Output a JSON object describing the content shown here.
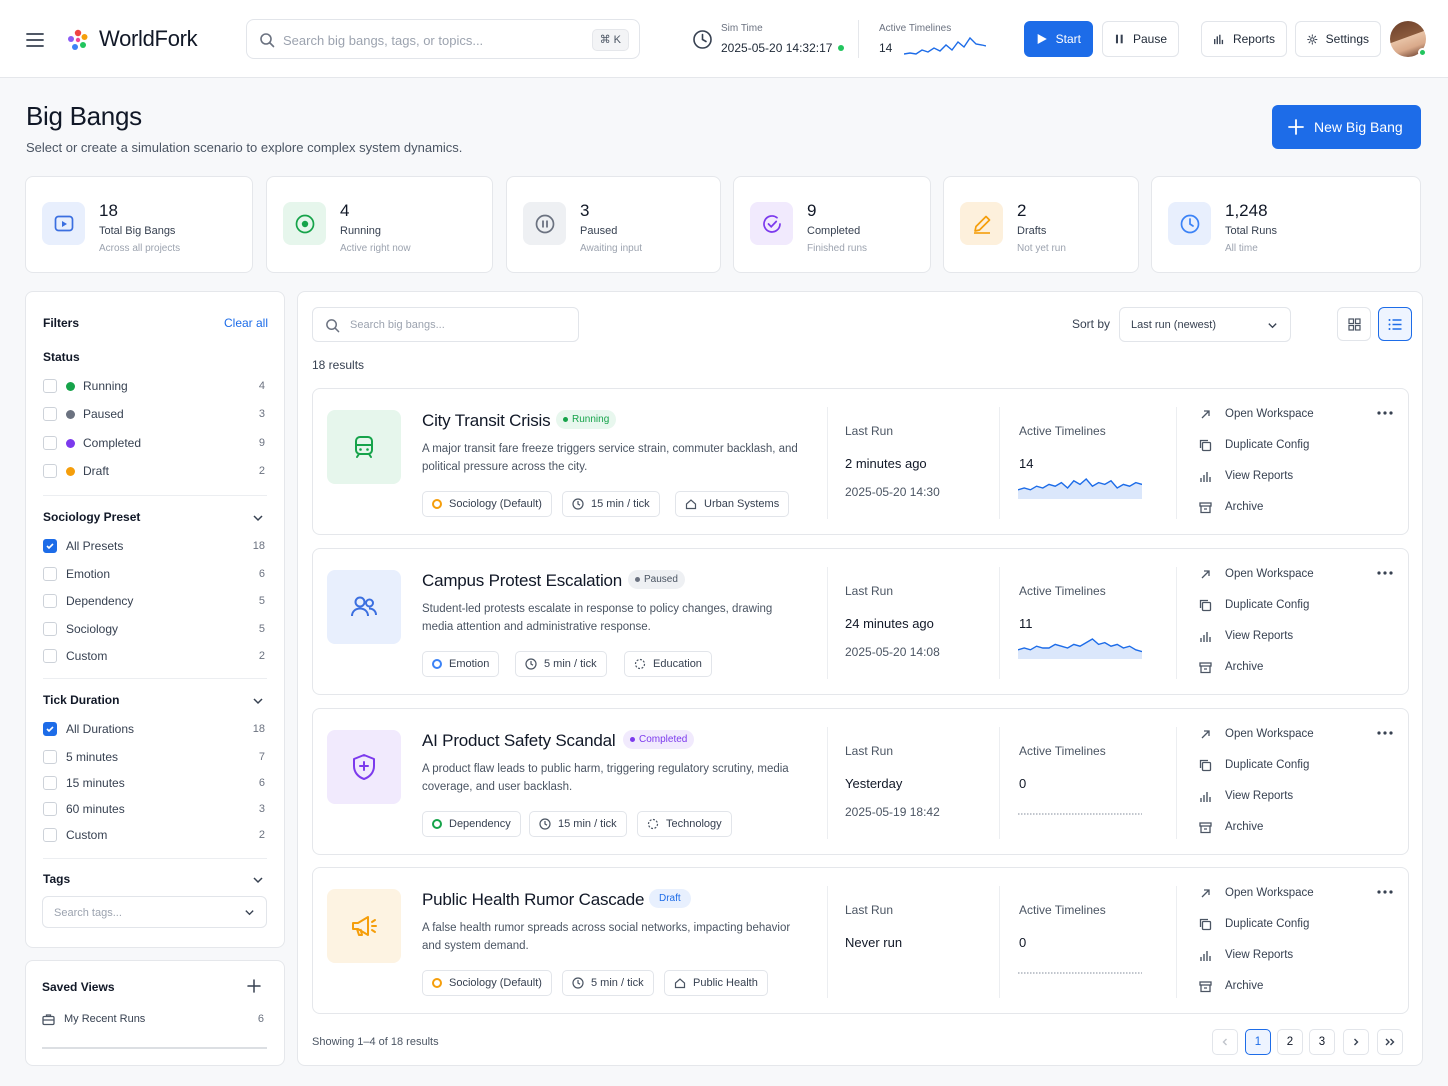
{
  "app": {
    "name": "WorldFork"
  },
  "search": {
    "placeholder": "Search big bangs, tags, or topics...",
    "shortcut": "⌘ K"
  },
  "sim": {
    "time_label": "Sim Time",
    "time_value": "2025-05-20 14:32:17",
    "timelines_label": "Active Timelines",
    "timelines_value": "14"
  },
  "toolbar": {
    "start": "Start",
    "pause": "Pause",
    "reports": "Reports",
    "settings": "Settings"
  },
  "page": {
    "title": "Big Bangs",
    "subtitle": "Select or create a simulation scenario to explore complex system dynamics.",
    "new_button": "New Big Bang"
  },
  "stats": [
    {
      "value": "18",
      "label": "Total Big Bangs",
      "sub": "Across all projects",
      "icon": "grid-play-icon",
      "color": "#3b6fe0"
    },
    {
      "value": "4",
      "label": "Running",
      "sub": "Active right now",
      "icon": "target-icon",
      "color": "#16a34a"
    },
    {
      "value": "3",
      "label": "Paused",
      "sub": "Awaiting input",
      "icon": "pause-circle-icon",
      "color": "#6b7280"
    },
    {
      "value": "9",
      "label": "Completed",
      "sub": "Finished runs",
      "icon": "check-circle-icon",
      "color": "#7c3aed"
    },
    {
      "value": "2",
      "label": "Drafts",
      "sub": "Not yet run",
      "icon": "pencil-icon",
      "color": "#f59e0b"
    },
    {
      "value": "1,248",
      "label": "Total Runs",
      "sub": "All time",
      "icon": "clock-icon",
      "color": "#3b82f6"
    }
  ],
  "filters": {
    "title": "Filters",
    "clear": "Clear all",
    "status_title": "Status",
    "status": [
      {
        "label": "Running",
        "count": "4",
        "color": "#16a34a"
      },
      {
        "label": "Paused",
        "count": "3",
        "color": "#6b7280"
      },
      {
        "label": "Completed",
        "count": "9",
        "color": "#7c3aed"
      },
      {
        "label": "Draft",
        "count": "2",
        "color": "#f59e0b"
      }
    ],
    "preset_title": "Sociology Preset",
    "presets": [
      {
        "label": "All Presets",
        "count": "18",
        "checked": true
      },
      {
        "label": "Emotion",
        "count": "6",
        "checked": false
      },
      {
        "label": "Dependency",
        "count": "5",
        "checked": false
      },
      {
        "label": "Sociology",
        "count": "5",
        "checked": false
      },
      {
        "label": "Custom",
        "count": "2",
        "checked": false
      }
    ],
    "tick_title": "Tick Duration",
    "ticks": [
      {
        "label": "All Durations",
        "count": "18",
        "checked": true
      },
      {
        "label": "5 minutes",
        "count": "7",
        "checked": false
      },
      {
        "label": "15 minutes",
        "count": "6",
        "checked": false
      },
      {
        "label": "60 minutes",
        "count": "3",
        "checked": false
      },
      {
        "label": "Custom",
        "count": "2",
        "checked": false
      }
    ],
    "tags_title": "Tags",
    "tags_placeholder": "Search tags..."
  },
  "saved": {
    "title": "Saved Views",
    "items": [
      {
        "label": "My Recent Runs",
        "count": "6"
      }
    ]
  },
  "list": {
    "search_placeholder": "Search big bangs...",
    "sort_label": "Sort by",
    "sort_value": "Last run (newest)",
    "results": "18 results",
    "last_run_label": "Last Run",
    "timelines_label": "Active Timelines",
    "actions": [
      "Open Workspace",
      "Duplicate Config",
      "View Reports",
      "Archive"
    ],
    "items": [
      {
        "title": "City Transit Crisis",
        "status": "Running",
        "status_color": "#16a34a",
        "status_bg": "#e8f7ee",
        "desc": "A major transit fare freeze triggers service strain, commuter backlash, and political pressure across the city.",
        "preset": "Sociology (Default)",
        "preset_color": "#f59e0b",
        "tick": "15 min / tick",
        "tag": "Urban Systems",
        "tag_icon": "home-icon",
        "last_run": "2 minutes ago",
        "last_run_date": "2025-05-20 14:30",
        "timelines": "14",
        "trend": [
          4,
          5,
          4,
          6,
          5,
          7,
          6,
          8,
          5,
          9,
          7,
          10,
          6,
          8,
          7,
          9,
          5,
          7,
          6,
          8,
          7
        ],
        "icon": "train-icon",
        "icon_color": "#16a34a",
        "thumb_bg": "#e6f6ec"
      },
      {
        "title": "Campus Protest Escalation",
        "status": "Paused",
        "status_color": "#4b5563",
        "status_bg": "#eef0f3",
        "desc": "Student-led protests escalate in response to policy changes, drawing media attention and administrative response.",
        "preset": "Emotion",
        "preset_color": "#3b82f6",
        "tick": "5 min / tick",
        "tag": "Education",
        "tag_icon": "dashed-circle-icon",
        "last_run": "24 minutes ago",
        "last_run_date": "2025-05-20 14:08",
        "timelines": "11",
        "trend": [
          4,
          5,
          4,
          6,
          5,
          5,
          7,
          6,
          5,
          7,
          6,
          8,
          10,
          7,
          8,
          6,
          7,
          5,
          6,
          4,
          3
        ],
        "icon": "users-icon",
        "icon_color": "#3b6fe0",
        "thumb_bg": "#e8effd"
      },
      {
        "title": "AI Product Safety Scandal",
        "status": "Completed",
        "status_color": "#7c3aed",
        "status_bg": "#f1eafd",
        "desc": "A product flaw leads to public harm, triggering regulatory scrutiny, media coverage, and user backlash.",
        "preset": "Dependency",
        "preset_color": "#16a34a",
        "tick": "15 min / tick",
        "tag": "Technology",
        "tag_icon": "dashed-circle-icon",
        "last_run": "Yesterday",
        "last_run_date": "2025-05-19 18:42",
        "timelines": "0",
        "trend": [],
        "icon": "shield-icon",
        "icon_color": "#7c3aed",
        "thumb_bg": "#f1eafd"
      },
      {
        "title": "Public Health Rumor Cascade",
        "status": "Draft",
        "status_color": "#1d6ce8",
        "status_bg": "#e8f0fe",
        "desc": "A false health rumor spreads across social networks, impacting behavior and system demand.",
        "preset": "Sociology (Default)",
        "preset_color": "#f59e0b",
        "tick": "5 min / tick",
        "tag": "Public Health",
        "tag_icon": "home-icon",
        "last_run": "Never run",
        "last_run_date": "",
        "timelines": "0",
        "trend": [],
        "icon": "megaphone-icon",
        "icon_color": "#f59e0b",
        "thumb_bg": "#fdf3e2"
      }
    ],
    "showing": "Showing 1–4 of 18 results",
    "pages": [
      "1",
      "2",
      "3"
    ]
  }
}
